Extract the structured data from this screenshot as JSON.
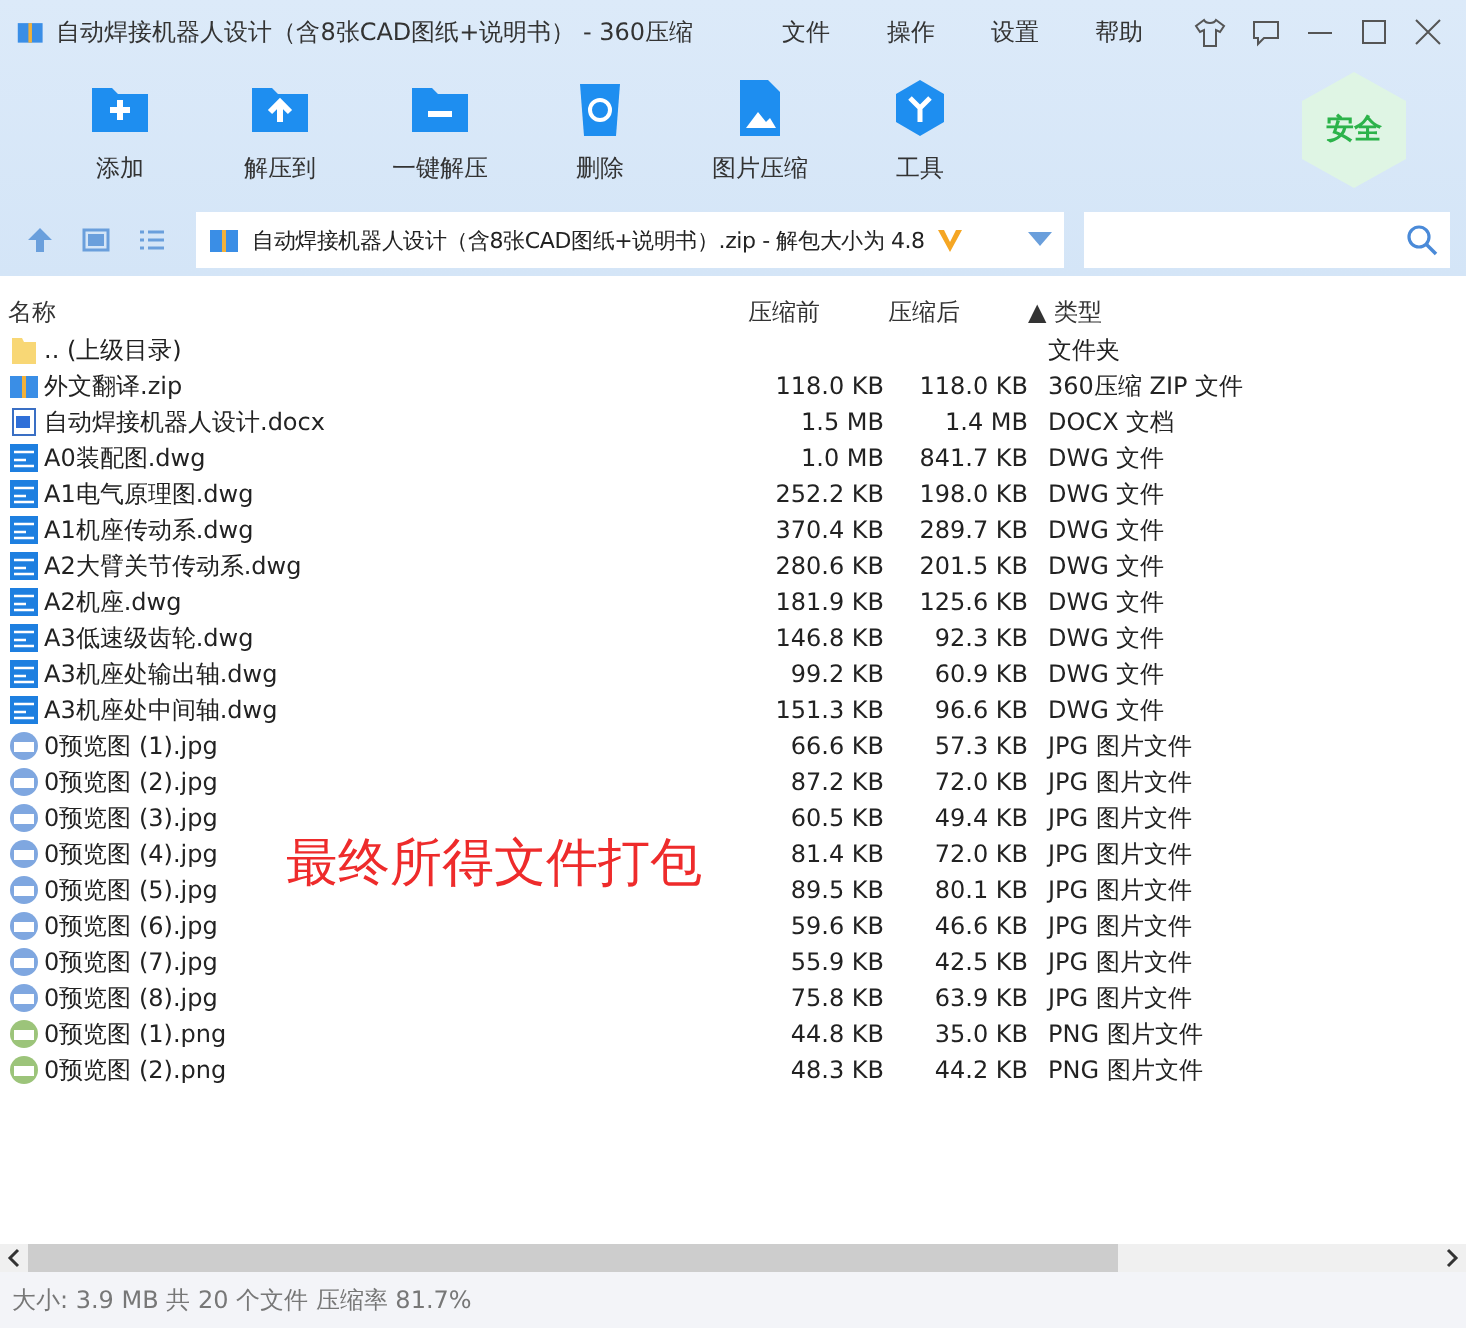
{
  "window": {
    "title": "自动焊接机器人设计（含8张CAD图纸+说明书） - 360压缩"
  },
  "menu": [
    "文件",
    "操作",
    "设置",
    "帮助"
  ],
  "toolbar": [
    {
      "label": "添加",
      "kind": "add"
    },
    {
      "label": "解压到",
      "kind": "extract"
    },
    {
      "label": "一键解压",
      "kind": "quick"
    },
    {
      "label": "删除",
      "kind": "delete"
    },
    {
      "label": "图片压缩",
      "kind": "image"
    },
    {
      "label": "工具",
      "kind": "tools"
    }
  ],
  "security_badge": "安全",
  "address": {
    "value": "自动焊接机器人设计（含8张CAD图纸+说明书）.zip - 解包大小为 4.8"
  },
  "table": {
    "columns": [
      "名称",
      "压缩前",
      "压缩后",
      "▲ 类型"
    ],
    "rows": [
      {
        "kind": "folder",
        "name": ".. (上级目录)",
        "before": "",
        "after": "",
        "type": "文件夹"
      },
      {
        "kind": "zip",
        "name": "外文翻译.zip",
        "before": "118.0 KB",
        "after": "118.0 KB",
        "type": "360压缩 ZIP 文件"
      },
      {
        "kind": "docx",
        "name": "自动焊接机器人设计.docx",
        "before": "1.5 MB",
        "after": "1.4 MB",
        "type": "DOCX 文档"
      },
      {
        "kind": "dwg",
        "name": "A0装配图.dwg",
        "before": "1.0 MB",
        "after": "841.7 KB",
        "type": "DWG 文件"
      },
      {
        "kind": "dwg",
        "name": "A1电气原理图.dwg",
        "before": "252.2 KB",
        "after": "198.0 KB",
        "type": "DWG 文件"
      },
      {
        "kind": "dwg",
        "name": "A1机座传动系.dwg",
        "before": "370.4 KB",
        "after": "289.7 KB",
        "type": "DWG 文件"
      },
      {
        "kind": "dwg",
        "name": "A2大臂关节传动系.dwg",
        "before": "280.6 KB",
        "after": "201.5 KB",
        "type": "DWG 文件"
      },
      {
        "kind": "dwg",
        "name": "A2机座.dwg",
        "before": "181.9 KB",
        "after": "125.6 KB",
        "type": "DWG 文件"
      },
      {
        "kind": "dwg",
        "name": "A3低速级齿轮.dwg",
        "before": "146.8 KB",
        "after": "92.3 KB",
        "type": "DWG 文件"
      },
      {
        "kind": "dwg",
        "name": "A3机座处输出轴.dwg",
        "before": "99.2 KB",
        "after": "60.9 KB",
        "type": "DWG 文件"
      },
      {
        "kind": "dwg",
        "name": "A3机座处中间轴.dwg",
        "before": "151.3 KB",
        "after": "96.6 KB",
        "type": "DWG 文件"
      },
      {
        "kind": "jpg",
        "name": "0预览图 (1).jpg",
        "before": "66.6 KB",
        "after": "57.3 KB",
        "type": "JPG 图片文件"
      },
      {
        "kind": "jpg",
        "name": "0预览图 (2).jpg",
        "before": "87.2 KB",
        "after": "72.0 KB",
        "type": "JPG 图片文件"
      },
      {
        "kind": "jpg",
        "name": "0预览图 (3).jpg",
        "before": "60.5 KB",
        "after": "49.4 KB",
        "type": "JPG 图片文件"
      },
      {
        "kind": "jpg",
        "name": "0预览图 (4).jpg",
        "before": "81.4 KB",
        "after": "72.0 KB",
        "type": "JPG 图片文件"
      },
      {
        "kind": "jpg",
        "name": "0预览图 (5).jpg",
        "before": "89.5 KB",
        "after": "80.1 KB",
        "type": "JPG 图片文件"
      },
      {
        "kind": "jpg",
        "name": "0预览图 (6).jpg",
        "before": "59.6 KB",
        "after": "46.6 KB",
        "type": "JPG 图片文件"
      },
      {
        "kind": "jpg",
        "name": "0预览图 (7).jpg",
        "before": "55.9 KB",
        "after": "42.5 KB",
        "type": "JPG 图片文件"
      },
      {
        "kind": "jpg",
        "name": "0预览图 (8).jpg",
        "before": "75.8 KB",
        "after": "63.9 KB",
        "type": "JPG 图片文件"
      },
      {
        "kind": "png",
        "name": "0预览图 (1).png",
        "before": "44.8 KB",
        "after": "35.0 KB",
        "type": "PNG 图片文件"
      },
      {
        "kind": "png",
        "name": "0预览图 (2).png",
        "before": "48.3 KB",
        "after": "44.2 KB",
        "type": "PNG 图片文件"
      }
    ]
  },
  "annotation": "最终所得文件打包",
  "status_bar": "大小: 3.9 MB 共 20 个文件 压缩率 81.7%"
}
